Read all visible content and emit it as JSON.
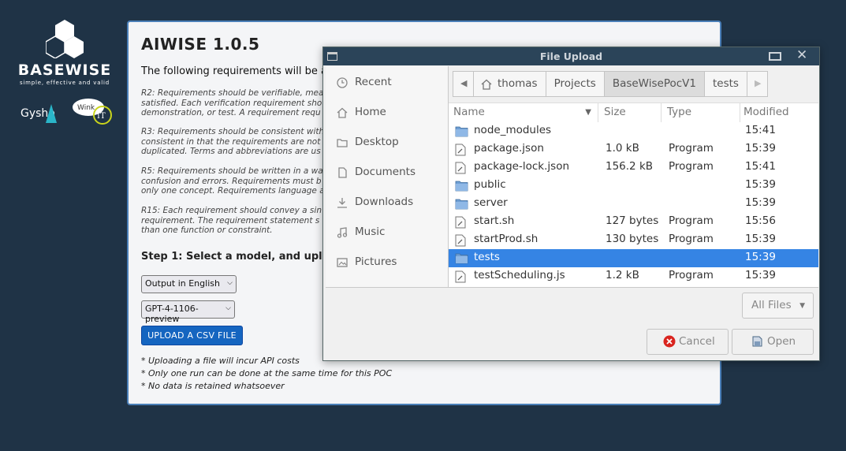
{
  "brand": {
    "name": "BASEWISE",
    "tagline": "simple, effective and valid",
    "partner1": "Gysho",
    "partner2_top": "Wink",
    "partner2_bottom": "IT"
  },
  "app": {
    "title": "AIWISE 1.0.5",
    "intro": "The following requirements will be a",
    "requirements": [
      [
        "R2: Requirements should be verifiable, mea",
        "satisfied. Each verification requirement sho",
        "demonstration, or test. A requirement requ"
      ],
      [
        "R3: Requirements should be consistent with",
        "consistent in that the requirements are not",
        "duplicated. Terms and abbreviations are us"
      ],
      [
        "R5: Requirements should be written in a wa",
        "confusion and errors. Requirements must b",
        "only one concept. Requirements language a"
      ],
      [
        "R15: Each requirement should convey a sin",
        "requirement. The requirement statement s",
        "than one function or constraint."
      ]
    ],
    "step1": "Step 1: Select a model, and uplo",
    "language_select": "Output in English",
    "model_select": "GPT-4-1106-preview",
    "upload_label": "UPLOAD A CSV FILE",
    "notes": [
      "* Uploading a file will incur API costs",
      "* Only one run can be done at the same time for this POC",
      "* No data is retained whatsoever"
    ]
  },
  "dialog": {
    "title": "File Upload",
    "sidebar": [
      {
        "label": "Recent",
        "icon": "clock-icon"
      },
      {
        "label": "Home",
        "icon": "home-icon"
      },
      {
        "label": "Desktop",
        "icon": "folder-icon"
      },
      {
        "label": "Documents",
        "icon": "document-icon"
      },
      {
        "label": "Downloads",
        "icon": "download-icon"
      },
      {
        "label": "Music",
        "icon": "music-icon"
      },
      {
        "label": "Pictures",
        "icon": "picture-icon"
      }
    ],
    "path": [
      "thomas",
      "Projects",
      "BaseWisePocV1",
      "tests"
    ],
    "columns": {
      "name": "Name",
      "size": "Size",
      "type": "Type",
      "modified": "Modified"
    },
    "files": [
      {
        "name": "node_modules",
        "size": "",
        "type": "",
        "modified": "15:41",
        "kind": "folder"
      },
      {
        "name": "package.json",
        "size": "1.0 kB",
        "type": "Program",
        "modified": "15:39",
        "kind": "file"
      },
      {
        "name": "package-lock.json",
        "size": "156.2 kB",
        "type": "Program",
        "modified": "15:41",
        "kind": "file"
      },
      {
        "name": "public",
        "size": "",
        "type": "",
        "modified": "15:39",
        "kind": "folder"
      },
      {
        "name": "server",
        "size": "",
        "type": "",
        "modified": "15:39",
        "kind": "folder"
      },
      {
        "name": "start.sh",
        "size": "127 bytes",
        "type": "Program",
        "modified": "15:56",
        "kind": "file"
      },
      {
        "name": "startProd.sh",
        "size": "130 bytes",
        "type": "Program",
        "modified": "15:39",
        "kind": "file"
      },
      {
        "name": "tests",
        "size": "",
        "type": "",
        "modified": "15:39",
        "kind": "folder",
        "selected": true
      },
      {
        "name": "testScheduling.js",
        "size": "1.2 kB",
        "type": "Program",
        "modified": "15:39",
        "kind": "file"
      }
    ],
    "filter": "All Files",
    "cancel": "Cancel",
    "open": "Open",
    "colors": {
      "titlebar": "#2b4459",
      "selection": "#3584e4",
      "accent": "#1565c0"
    }
  }
}
